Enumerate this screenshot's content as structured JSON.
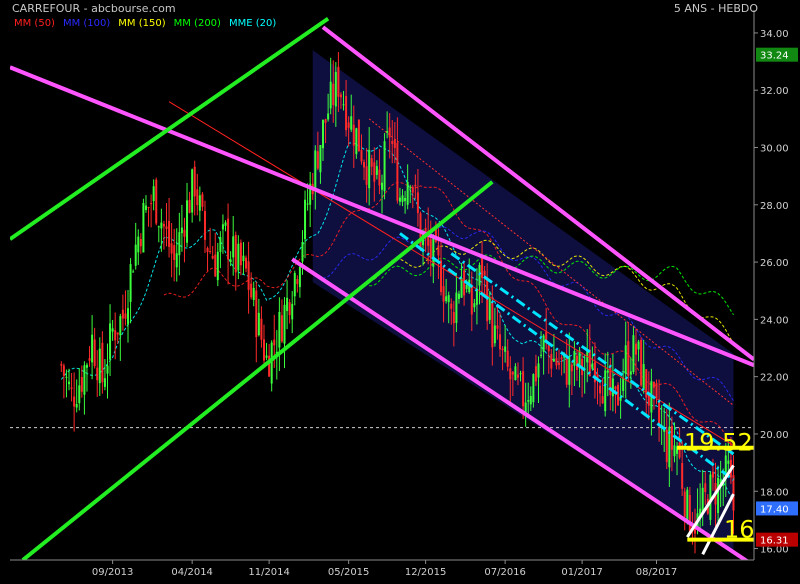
{
  "header": {
    "title": "CARREFOUR - abcbourse.com",
    "period": "5 ANS - HEBDO"
  },
  "legend": [
    {
      "label": "MM (50)",
      "color": "#ff2020"
    },
    {
      "label": "MM (100)",
      "color": "#2a2aff"
    },
    {
      "label": "MM (150)",
      "color": "#ffff00"
    },
    {
      "label": "MM (200)",
      "color": "#00ff00"
    },
    {
      "label": "MME (20)",
      "color": "#00ffff"
    }
  ],
  "colors": {
    "background": "#000000",
    "candle_up": "#3cff3c",
    "candle_down": "#ff2a2a",
    "channel_magenta": "#ff55ff",
    "channel_green": "#22ee22",
    "channel_cyan": "#00e5ff",
    "support": "#ffff00",
    "channel_fill": "#10104a",
    "last_price_badge": "#2f6fff",
    "top_badge": "#118811",
    "bottom_badge": "#bb0000"
  },
  "chart_data": {
    "type": "candlestick",
    "title": "CARREFOUR - abcbourse.com",
    "period": "5 ANS - HEBDO",
    "ylim": [
      15.6,
      34.8
    ],
    "y_ticks": [
      16.0,
      18.0,
      20.0,
      22.0,
      24.0,
      26.0,
      28.0,
      30.0,
      32.0,
      34.0
    ],
    "y_tick_labels": [
      "16.00",
      "18.00",
      "20.00",
      "22.00",
      "24.00",
      "26.00",
      "28.00",
      "30.00",
      "32.00",
      "34.00"
    ],
    "x_tick_labels": [
      {
        "label": "09/2013",
        "week": 20
      },
      {
        "label": "04/2014",
        "week": 51
      },
      {
        "label": "11/2014",
        "week": 81
      },
      {
        "label": "05/2015",
        "week": 112
      },
      {
        "label": "12/2015",
        "week": 142
      },
      {
        "label": "07/2016",
        "week": 173
      },
      {
        "label": "01/2017",
        "week": 203
      },
      {
        "label": "08/2017",
        "week": 232
      }
    ],
    "week_range": [
      -20,
      270
    ],
    "anchor_closes": [
      [
        0,
        22.4
      ],
      [
        4,
        21.3
      ],
      [
        8,
        22.0
      ],
      [
        12,
        23.3
      ],
      [
        16,
        21.9
      ],
      [
        20,
        23.6
      ],
      [
        24,
        24.1
      ],
      [
        28,
        26.2
      ],
      [
        32,
        27.6
      ],
      [
        36,
        28.3
      ],
      [
        40,
        27.2
      ],
      [
        44,
        26.0
      ],
      [
        48,
        27.6
      ],
      [
        52,
        28.8
      ],
      [
        56,
        26.8
      ],
      [
        60,
        26.1
      ],
      [
        64,
        26.9
      ],
      [
        68,
        26.0
      ],
      [
        72,
        25.6
      ],
      [
        76,
        24.1
      ],
      [
        80,
        22.6
      ],
      [
        84,
        23.4
      ],
      [
        88,
        24.6
      ],
      [
        92,
        25.9
      ],
      [
        96,
        28.1
      ],
      [
        100,
        29.9
      ],
      [
        104,
        31.3
      ],
      [
        108,
        32.3
      ],
      [
        112,
        31.1
      ],
      [
        116,
        30.2
      ],
      [
        120,
        29.2
      ],
      [
        124,
        28.4
      ],
      [
        128,
        30.6
      ],
      [
        132,
        28.3
      ],
      [
        136,
        29.3
      ],
      [
        140,
        26.9
      ],
      [
        144,
        26.3
      ],
      [
        148,
        25.6
      ],
      [
        152,
        24.1
      ],
      [
        156,
        25.6
      ],
      [
        160,
        24.3
      ],
      [
        164,
        25.8
      ],
      [
        168,
        23.6
      ],
      [
        172,
        22.6
      ],
      [
        176,
        21.7
      ],
      [
        180,
        21.3
      ],
      [
        184,
        21.9
      ],
      [
        188,
        23.1
      ],
      [
        192,
        22.6
      ],
      [
        196,
        22.3
      ],
      [
        200,
        22.3
      ],
      [
        204,
        22.3
      ],
      [
        208,
        22.6
      ],
      [
        212,
        21.6
      ],
      [
        216,
        21.0
      ],
      [
        220,
        22.6
      ],
      [
        224,
        22.9
      ],
      [
        228,
        21.6
      ],
      [
        232,
        20.6
      ],
      [
        236,
        19.6
      ],
      [
        240,
        19.6
      ],
      [
        244,
        17.3
      ],
      [
        248,
        16.9
      ],
      [
        252,
        17.9
      ],
      [
        256,
        18.2
      ],
      [
        260,
        18.6
      ],
      [
        262,
        17.4
      ]
    ],
    "ma_anchors": {
      "MME (20)": [
        [
          0,
          21.9
        ],
        [
          20,
          22.5
        ],
        [
          40,
          26.6
        ],
        [
          60,
          26.9
        ],
        [
          80,
          24.6
        ],
        [
          100,
          27.1
        ],
        [
          112,
          29.9
        ],
        [
          124,
          30.2
        ],
        [
          140,
          28.1
        ],
        [
          160,
          25.6
        ],
        [
          180,
          23.1
        ],
        [
          200,
          22.6
        ],
        [
          220,
          21.9
        ],
        [
          232,
          21.1
        ],
        [
          244,
          19.3
        ],
        [
          262,
          17.8
        ]
      ],
      "MM (50)": [
        [
          40,
          24.6
        ],
        [
          60,
          25.6
        ],
        [
          80,
          25.1
        ],
        [
          100,
          26.3
        ],
        [
          120,
          28.1
        ],
        [
          140,
          28.9
        ],
        [
          160,
          27.3
        ],
        [
          180,
          25.3
        ],
        [
          200,
          23.6
        ],
        [
          220,
          22.6
        ],
        [
          240,
          21.3
        ],
        [
          262,
          19.6
        ]
      ],
      "MM (100)": [
        [
          100,
          25.6
        ],
        [
          120,
          26.3
        ],
        [
          140,
          26.9
        ],
        [
          160,
          27.1
        ],
        [
          180,
          26.1
        ],
        [
          200,
          25.1
        ],
        [
          220,
          23.9
        ],
        [
          240,
          22.6
        ],
        [
          262,
          21.3
        ]
      ],
      "MM (150)": [
        [
          120,
          25.6
        ],
        [
          140,
          26.1
        ],
        [
          160,
          26.6
        ],
        [
          180,
          26.3
        ],
        [
          200,
          26.0
        ],
        [
          220,
          25.6
        ],
        [
          240,
          24.9
        ],
        [
          262,
          23.3
        ]
      ],
      "MM (200)": [
        [
          120,
          25.4
        ],
        [
          140,
          25.8
        ],
        [
          160,
          26.0
        ],
        [
          180,
          26.0
        ],
        [
          200,
          25.8
        ],
        [
          220,
          25.6
        ],
        [
          240,
          25.6
        ],
        [
          262,
          24.3
        ]
      ]
    },
    "trendlines": {
      "magenta_upper": [
        [
          -20,
          32.8
        ],
        [
          270,
          22.4
        ]
      ],
      "magenta_upper_outer": [
        [
          102,
          34.2
        ],
        [
          270,
          22.6
        ]
      ],
      "magenta_lower": [
        [
          90,
          26.1
        ],
        [
          270,
          15.4
        ]
      ],
      "green_upper": [
        [
          -20,
          26.8
        ],
        [
          104,
          34.5
        ]
      ],
      "green_lower": [
        [
          -15,
          15.6
        ],
        [
          168,
          28.8
        ]
      ],
      "cyan_upper": [
        [
          152,
          26.3
        ],
        [
          262,
          19.3
        ]
      ],
      "cyan_lower": [
        [
          132,
          27.0
        ],
        [
          262,
          18.4
        ]
      ],
      "red_mid_upper": [
        [
          42,
          31.6
        ],
        [
          262,
          19.6
        ]
      ],
      "red_dotted": [
        [
          120,
          31.0
        ],
        [
          262,
          21.0
        ]
      ],
      "white_up_1": [
        [
          244,
          16.4
        ],
        [
          262,
          18.9
        ]
      ],
      "white_up_2": [
        [
          250,
          15.8
        ],
        [
          262,
          17.9
        ]
      ],
      "channel_fill_poly": [
        [
          98,
          33.4
        ],
        [
          262,
          22.8
        ],
        [
          262,
          15.9
        ],
        [
          98,
          25.3
        ]
      ]
    },
    "support_levels": [
      {
        "value": 19.52,
        "label": "19.52",
        "from_week": 240
      },
      {
        "value": 16.31,
        "label": "16",
        "from_week": 244
      }
    ],
    "reference_line": 20.22,
    "badges": [
      {
        "value": 33.24,
        "label": "33.24",
        "color": "#118811"
      },
      {
        "value": 17.4,
        "label": "17.40",
        "color": "#2f6fff"
      },
      {
        "value": 16.31,
        "label": "16.31",
        "color": "#bb0000"
      }
    ]
  }
}
